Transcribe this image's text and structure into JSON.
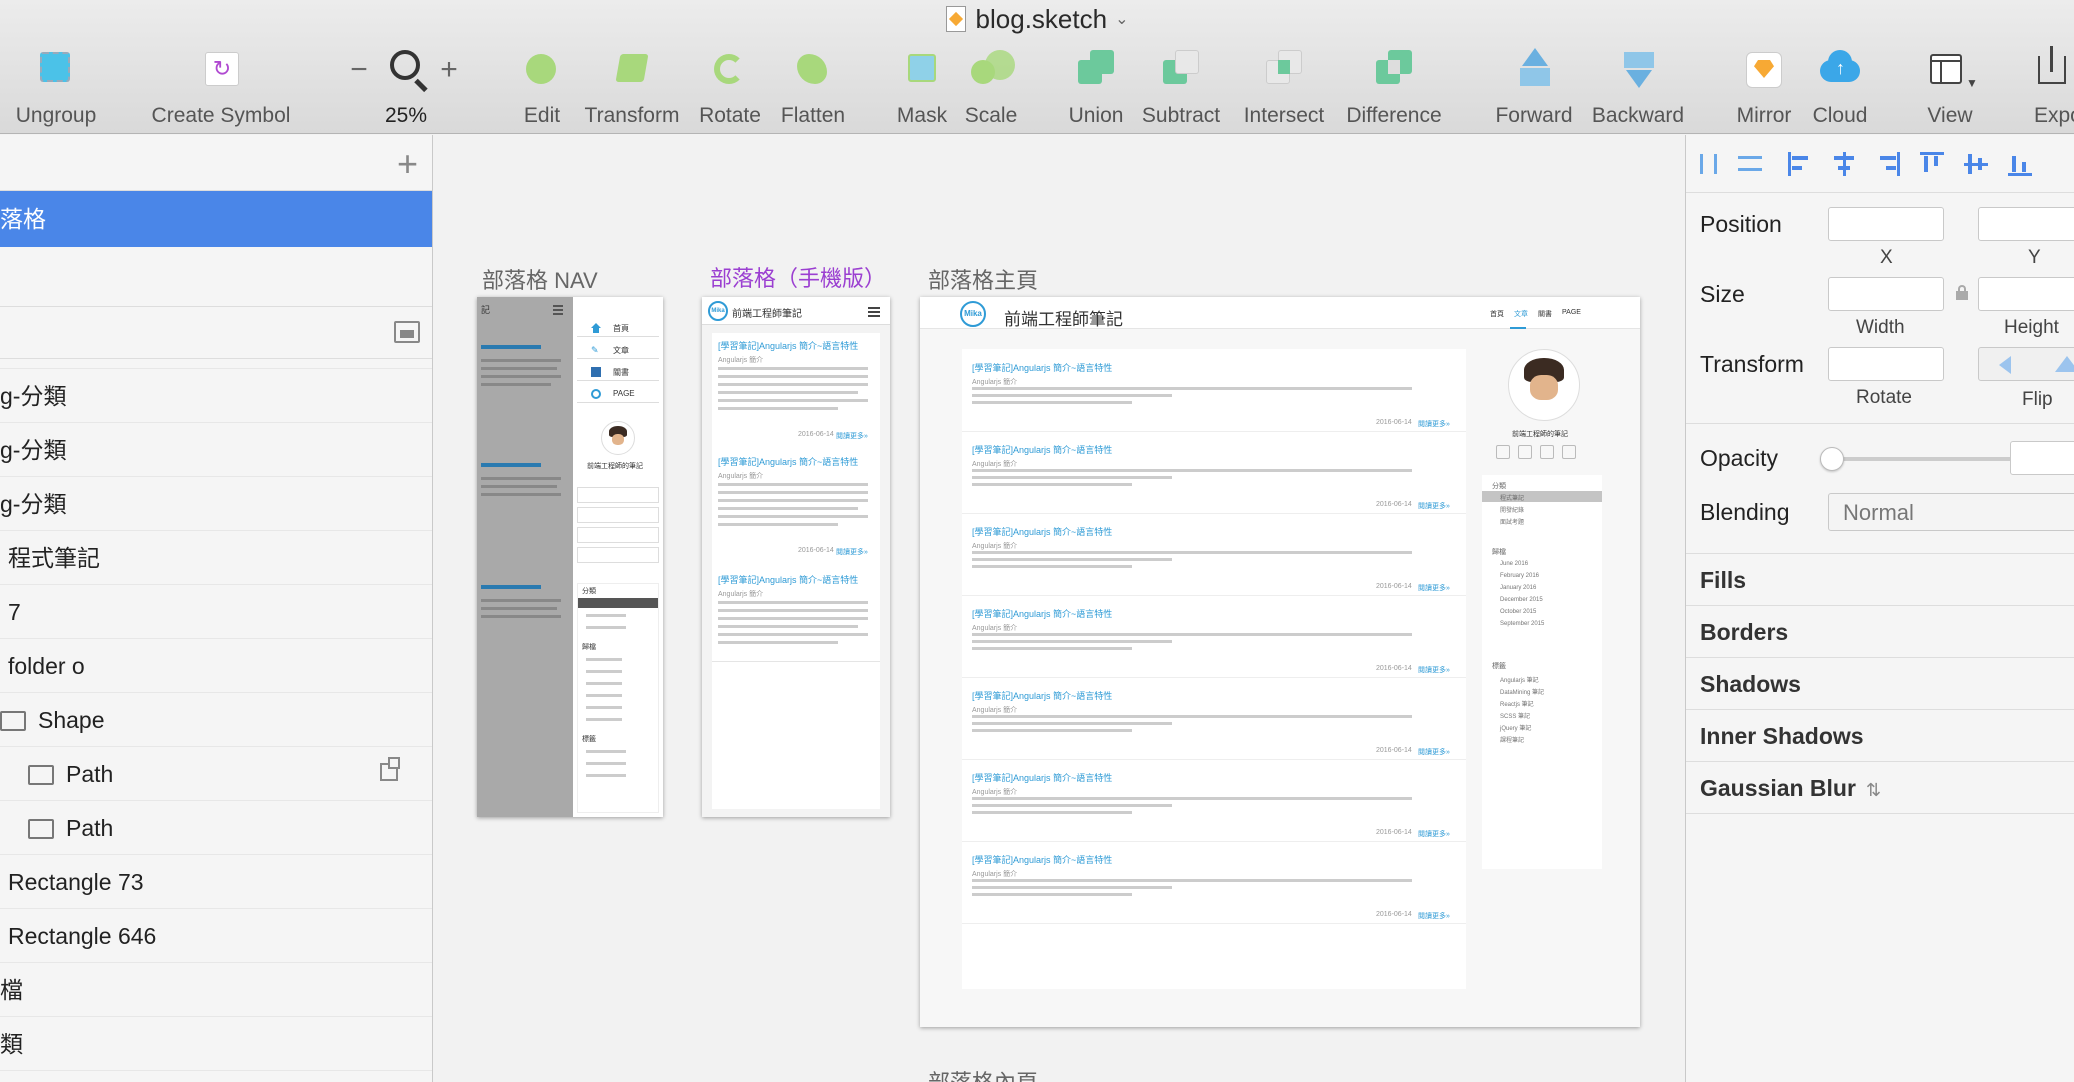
{
  "window": {
    "title": "blog.sketch"
  },
  "toolbar": {
    "ungroup": "Ungroup",
    "create_symbol": "Create Symbol",
    "zoom_minus": "−",
    "zoom_value": "25%",
    "zoom_plus": "+",
    "edit": "Edit",
    "transform": "Transform",
    "rotate": "Rotate",
    "flatten": "Flatten",
    "mask": "Mask",
    "scale": "Scale",
    "union": "Union",
    "subtract": "Subtract",
    "intersect": "Intersect",
    "difference": "Difference",
    "forward": "Forward",
    "backward": "Backward",
    "mirror": "Mirror",
    "cloud": "Cloud",
    "view": "View",
    "export": "Expo"
  },
  "layers": {
    "selected_page": "落格",
    "rows": [
      {
        "label": "g-分類",
        "indent": 0,
        "icon": ""
      },
      {
        "label": "g-分類",
        "indent": 0,
        "icon": ""
      },
      {
        "label": "g-分類",
        "indent": 0,
        "icon": ""
      },
      {
        "label": "程式筆記",
        "indent": 1,
        "icon": ""
      },
      {
        "label": "7",
        "indent": 1,
        "icon": ""
      },
      {
        "label": "folder o",
        "indent": 1,
        "icon": ""
      },
      {
        "label": "Shape",
        "indent": 0,
        "icon": "folder"
      },
      {
        "label": "Path",
        "indent": 1,
        "icon": "folder"
      },
      {
        "label": "Path",
        "indent": 1,
        "icon": "folder"
      },
      {
        "label": "Rectangle 73",
        "indent": 1,
        "icon": ""
      },
      {
        "label": "Rectangle 646",
        "indent": 1,
        "icon": ""
      },
      {
        "label": "檔",
        "indent": 0,
        "icon": ""
      },
      {
        "label": "類",
        "indent": 0,
        "icon": ""
      }
    ]
  },
  "canvas": {
    "artboards": {
      "nav": "部落格 NAV",
      "mobile": "部落格（手機版）",
      "home": "部落格主頁",
      "inner": "部落格內頁"
    },
    "blog": {
      "site_name": "前端工程師筆記",
      "logo_text": "Mika",
      "author": "前端工程師的筆記",
      "nav": [
        "首頁",
        "文章",
        "關書",
        "PAGE"
      ],
      "post_title": "[學習筆記]Angularjs 簡介~語言特性",
      "post_subtitle": "Angularjs 簡介",
      "post_date": "2016-06-14",
      "read_more": "閱讀更多»",
      "sidebar_categories_label": "分類",
      "categories": [
        "程式筆記",
        "開發紀錄",
        "面試考題"
      ],
      "sidebar_archive_label": "歸檔",
      "archives": [
        "June 2016",
        "February 2016",
        "January 2016",
        "December 2015",
        "October 2015",
        "September 2015"
      ],
      "sidebar_tags_label": "標籤",
      "tags": [
        "Angularjs 筆記",
        "DataMining 筆記",
        "Reactjs 筆記",
        "SCSS 筆記",
        "jQuery 筆記",
        "課程筆記"
      ],
      "nav_side_label": "記"
    }
  },
  "inspector": {
    "position_label": "Position",
    "x_label": "X",
    "y_label": "Y",
    "size_label": "Size",
    "width_label": "Width",
    "height_label": "Height",
    "transform_label": "Transform",
    "rotate_label": "Rotate",
    "flip_label": "Flip",
    "opacity_label": "Opacity",
    "blending_label": "Blending",
    "blending_value": "Normal",
    "opacity_level": 0,
    "sections": [
      "Fills",
      "Borders",
      "Shadows",
      "Inner Shadows",
      "Gaussian Blur"
    ]
  },
  "colors": {
    "accent": "#4a86e8",
    "link": "#2f9bd6",
    "mobile_title": "#9b3fd1"
  }
}
